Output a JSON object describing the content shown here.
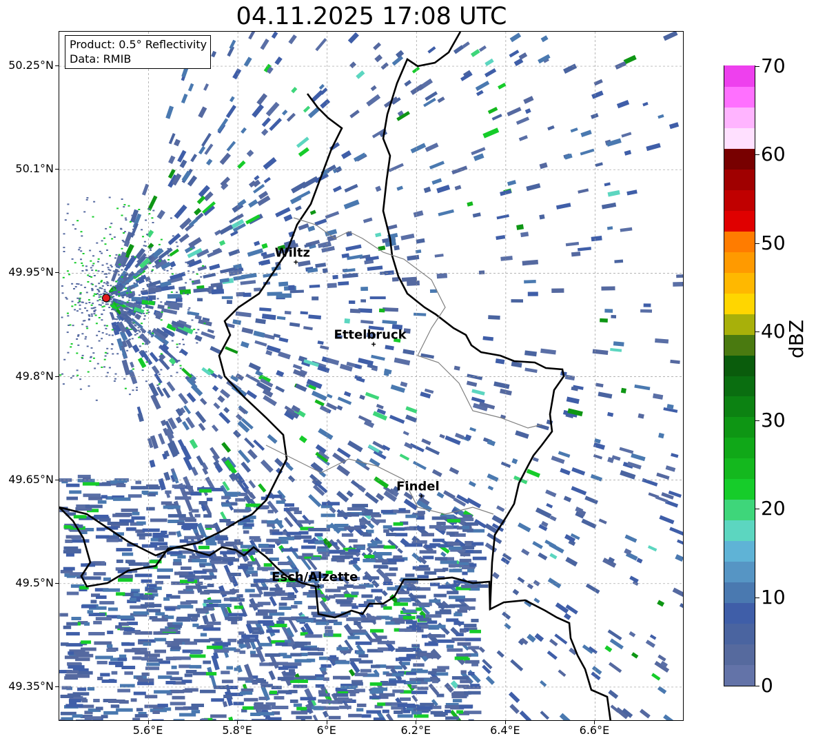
{
  "title": "04.11.2025 17:08 UTC",
  "info_box": {
    "product": "Product: 0.5° Reflectivity",
    "data": "Data: RMIB"
  },
  "map": {
    "lon_range": [
      5.4,
      6.8
    ],
    "lat_range": [
      49.3,
      50.3
    ],
    "lat_ticks": [
      {
        "value": 49.35,
        "label": "49.35°N"
      },
      {
        "value": 49.5,
        "label": "49.5°N"
      },
      {
        "value": 49.65,
        "label": "49.65°N"
      },
      {
        "value": 49.8,
        "label": "49.8°N"
      },
      {
        "value": 49.95,
        "label": "49.95°N"
      },
      {
        "value": 50.1,
        "label": "50.1°N"
      },
      {
        "value": 50.25,
        "label": "50.25°N"
      }
    ],
    "lon_ticks": [
      {
        "value": 5.6,
        "label": "5.6°E"
      },
      {
        "value": 5.8,
        "label": "5.8°E"
      },
      {
        "value": 6.0,
        "label": "6°E"
      },
      {
        "value": 6.2,
        "label": "6.2°E"
      },
      {
        "value": 6.4,
        "label": "6.4°E"
      },
      {
        "value": 6.6,
        "label": "6.6°E"
      }
    ],
    "gridlines": "dashed",
    "radar_site": {
      "lon": 5.505,
      "lat": 49.914,
      "color": "#e31a1c"
    },
    "cities": [
      {
        "name": "Wiltz",
        "lon": 5.93,
        "lat": 49.966
      },
      {
        "name": "Ettelbruck",
        "lon": 6.104,
        "lat": 49.847
      },
      {
        "name": "Findel",
        "lon": 6.211,
        "lat": 49.627
      },
      {
        "name": "Esch/Alzette",
        "lon": 5.98,
        "lat": 49.496
      }
    ]
  },
  "colorbar": {
    "label": "dBZ",
    "min": 0,
    "max": 70,
    "step": 2.5,
    "ticks": [
      "0",
      "10",
      "20",
      "30",
      "40",
      "50",
      "60",
      "70"
    ],
    "colors": [
      "#6373a8",
      "#566a9e",
      "#4a64a0",
      "#3f5ea8",
      "#4a79b0",
      "#5695c4",
      "#5fb3d6",
      "#5cd6c0",
      "#3ed67a",
      "#16cc2a",
      "#14b81e",
      "#10a818",
      "#0e9614",
      "#0c8212",
      "#0a6e10",
      "#0a5c0c",
      "#4a7a10",
      "#a8b00a",
      "#ffd600",
      "#ffb800",
      "#ff9a00",
      "#ff7c00",
      "#e00000",
      "#c00000",
      "#a00000",
      "#780000",
      "#ffe0ff",
      "#ffb4ff",
      "#ff70ff",
      "#ee40ee"
    ]
  }
}
